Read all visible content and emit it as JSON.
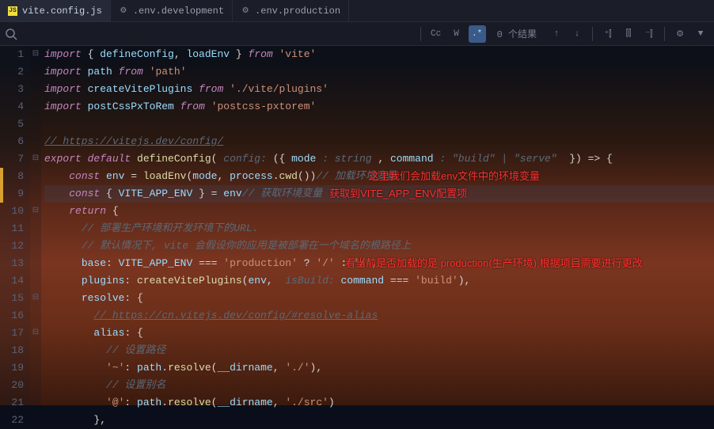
{
  "tabs": [
    {
      "label": "vite.config.js",
      "icon": "JS",
      "active": true
    },
    {
      "label": ".env.development",
      "icon": "⚙",
      "active": false
    },
    {
      "label": ".env.production",
      "icon": "⚙",
      "active": false
    }
  ],
  "findbar": {
    "placeholder": "",
    "cc_label": "Cc",
    "w_label": "W",
    "regex_label": ".*",
    "result_text": "0 个结果"
  },
  "annotations": {
    "a1": "这里我们会加载env文件中的环境变量",
    "a2": "获取到VITE_APP_ENV配置项",
    "a3": "看当前是否加载的是 production(生产环境),根据项目需要进行更改"
  },
  "code": {
    "l1": {
      "kw1": "import",
      "pn1": " { ",
      "id1": "defineConfig",
      "pn2": ", ",
      "id2": "loadEnv",
      "pn3": " } ",
      "kw2": "from",
      "sp": " ",
      "str1": "'vite'"
    },
    "l2": {
      "kw1": "import",
      "sp1": " ",
      "id1": "path",
      "sp2": " ",
      "kw2": "from",
      "sp3": " ",
      "str1": "'path'"
    },
    "l3": {
      "kw1": "import",
      "sp1": " ",
      "id1": "createVitePlugins",
      "sp2": " ",
      "kw2": "from",
      "sp3": " ",
      "str1": "'./vite/plugins'"
    },
    "l4": {
      "kw1": "import",
      "sp1": " ",
      "id1": "postCssPxToRem",
      "sp2": " ",
      "kw2": "from",
      "sp3": " ",
      "str1": "'postcss-pxtorem'"
    },
    "l6": {
      "cm": "// https://vitejs.dev/config/"
    },
    "l7": {
      "kw1": "export",
      "sp1": " ",
      "kw2": "default",
      "sp2": " ",
      "fn1": "defineConfig",
      "pn1": "(",
      "sp3": " ",
      "ty1": "config: ",
      "pn2": "({ ",
      "id1": "mode",
      "ty2": " : string ",
      "pn3": ", ",
      "id2": "command",
      "ty3": " : \"build\" | \"serve\"",
      "sp4": "  ",
      "pn4": "}) => {"
    },
    "l8": {
      "ind": "    ",
      "kw1": "const",
      "sp1": " ",
      "id1": "env",
      "sp2": " = ",
      "fn1": "loadEnv",
      "pn1": "(",
      "id2": "mode",
      "pn2": ", ",
      "id3": "process",
      "pn3": ".",
      "fn2": "cwd",
      "pn4": "())",
      "cm1": "// 加载环境变量"
    },
    "l9": {
      "ind": "    ",
      "kw1": "const",
      "sp1": " { ",
      "id1": "VITE_APP_ENV",
      "sp2": " } = ",
      "id2": "env",
      "cm1": "// 获取环境变量"
    },
    "l10": {
      "ind": "    ",
      "kw1": "return",
      "pn1": " {"
    },
    "l11": {
      "ind": "      ",
      "cm": "// 部署生产环境和开发环境下的URL."
    },
    "l12": {
      "ind": "      ",
      "cm": "// 默认情况下, vite 会假设你的应用是被部署在一个域名的根路径上"
    },
    "l13": {
      "ind": "      ",
      "prop1": "base",
      "pn1": ": ",
      "id1": "VITE_APP_ENV",
      "sp1": " === ",
      "str1": "'production'",
      "sp2": " ? ",
      "str2": "'/'",
      "sp3": " : ",
      "str3": "'/'",
      "pn2": ","
    },
    "l14": {
      "ind": "      ",
      "prop1": "plugins",
      "pn1": ": ",
      "fn1": "createVitePlugins",
      "pn2": "(",
      "id1": "env",
      "pn3": ",  ",
      "ty1": "isBuild: ",
      "id2": "command",
      "sp1": " === ",
      "str1": "'build'",
      "pn4": "),"
    },
    "l15": {
      "ind": "      ",
      "prop1": "resolve",
      "pn1": ": {"
    },
    "l16": {
      "ind": "        ",
      "cm": "// https://cn.vitejs.dev/config/#resolve-alias"
    },
    "l17": {
      "ind": "        ",
      "prop1": "alias",
      "pn1": ": {"
    },
    "l18": {
      "ind": "          ",
      "cm": "// 设置路径"
    },
    "l19": {
      "ind": "          ",
      "str1": "'~'",
      "pn1": ": ",
      "id1": "path",
      "pn2": ".",
      "fn1": "resolve",
      "pn3": "(",
      "id2": "__dirname",
      "pn4": ", ",
      "str2": "'./'",
      "pn5": "),"
    },
    "l20": {
      "ind": "          ",
      "cm": "// 设置别名"
    },
    "l21": {
      "ind": "          ",
      "str1": "'@'",
      "pn1": ": ",
      "id1": "path",
      "pn2": ".",
      "fn1": "resolve",
      "pn3": "(",
      "id2": "__dirname",
      "pn4": ", ",
      "str2": "'./src'",
      "pn5": ")"
    },
    "l22": {
      "ind": "        ",
      "pn1": "},"
    }
  },
  "line_numbers": [
    "1",
    "2",
    "3",
    "4",
    "5",
    "6",
    "7",
    "8",
    "9",
    "10",
    "11",
    "12",
    "13",
    "14",
    "15",
    "16",
    "17",
    "18",
    "19",
    "20",
    "21",
    "22"
  ],
  "fold_markers": [
    "⊟",
    "",
    "",
    "",
    "",
    "",
    "⊟",
    "",
    "",
    "⊟",
    "",
    "",
    "",
    "",
    "⊟",
    "",
    "⊟",
    "",
    "",
    "",
    "",
    ""
  ]
}
